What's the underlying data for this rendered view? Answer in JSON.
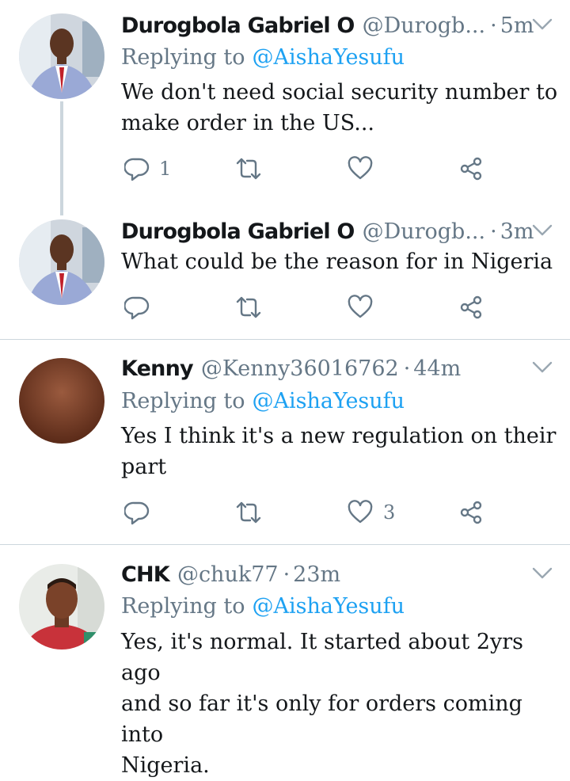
{
  "tweets": [
    {
      "name": "Durogbola Gabriel O",
      "handle": "@Durogb...",
      "separator": "·",
      "time": "5m",
      "replying_prefix": "Replying to",
      "replying_to": "@AishaYesufu",
      "lines": [
        "We don't need social security number to",
        "make order in the US..."
      ],
      "reply_count": "1",
      "retweet_count": "",
      "like_count": ""
    },
    {
      "name": "Durogbola Gabriel O",
      "handle": "@Durogb...",
      "separator": "·",
      "time": "3m",
      "lines": [
        "What could be the reason for in Nigeria"
      ],
      "reply_count": "",
      "retweet_count": "",
      "like_count": ""
    },
    {
      "name": "Kenny",
      "handle": "@Kenny36016762",
      "separator": "·",
      "time": "44m",
      "replying_prefix": "Replying to",
      "replying_to": "@AishaYesufu",
      "lines": [
        "Yes I think it's a new regulation on their",
        "part"
      ],
      "reply_count": "",
      "retweet_count": "",
      "like_count": "3"
    },
    {
      "name": "CHK",
      "handle": "@chuk77",
      "separator": "·",
      "time": "23m",
      "replying_prefix": "Replying to",
      "replying_to": "@AishaYesufu",
      "lines": [
        "Yes, it's normal. It started about 2yrs ago",
        "and so far it's only for orders coming into",
        "Nigeria."
      ]
    }
  ],
  "icons": {
    "reply": "reply-icon",
    "retweet": "retweet-icon",
    "like": "heart-icon",
    "share": "share-icon",
    "menu": "chevron-down-icon"
  },
  "colors": {
    "name": "#14171a",
    "secondary": "#657786",
    "link": "#1da1f2",
    "divider": "#ccd6dd"
  }
}
